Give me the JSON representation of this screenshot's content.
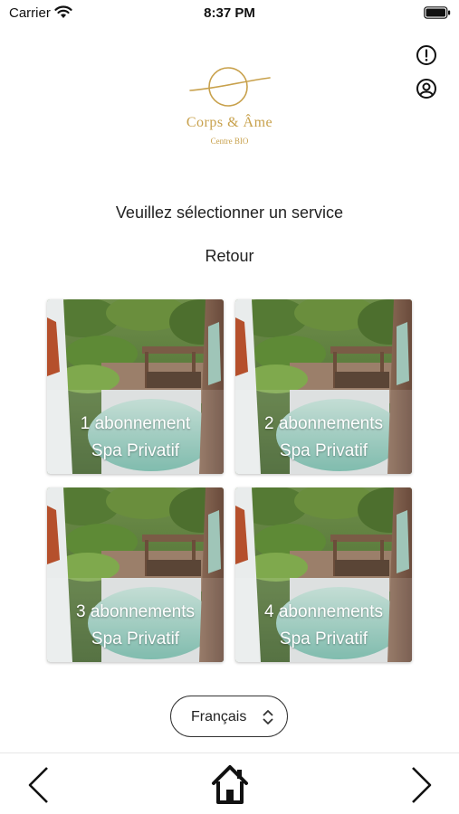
{
  "status_bar": {
    "carrier": "Carrier",
    "time": "8:37 PM"
  },
  "header": {
    "icons": [
      "alert-circle-icon",
      "user-circle-icon"
    ]
  },
  "brand": {
    "name": "Corps & Âme",
    "subtitle": "Centre BIO",
    "color": "#c8a14c"
  },
  "main": {
    "instruction": "Veuillez sélectionner un service",
    "back_label": "Retour",
    "services": [
      {
        "line1": "1 abonnement",
        "line2": "Spa Privatif"
      },
      {
        "line1": "2 abonnements",
        "line2": "Spa Privatif"
      },
      {
        "line1": "3 abonnements",
        "line2": "Spa Privatif"
      },
      {
        "line1": "4 abonnements",
        "line2": "Spa Privatif"
      }
    ]
  },
  "language": {
    "selected": "Français"
  },
  "bottom_nav": {
    "icons": [
      "chevron-left-icon",
      "home-icon",
      "chevron-right-icon"
    ]
  }
}
